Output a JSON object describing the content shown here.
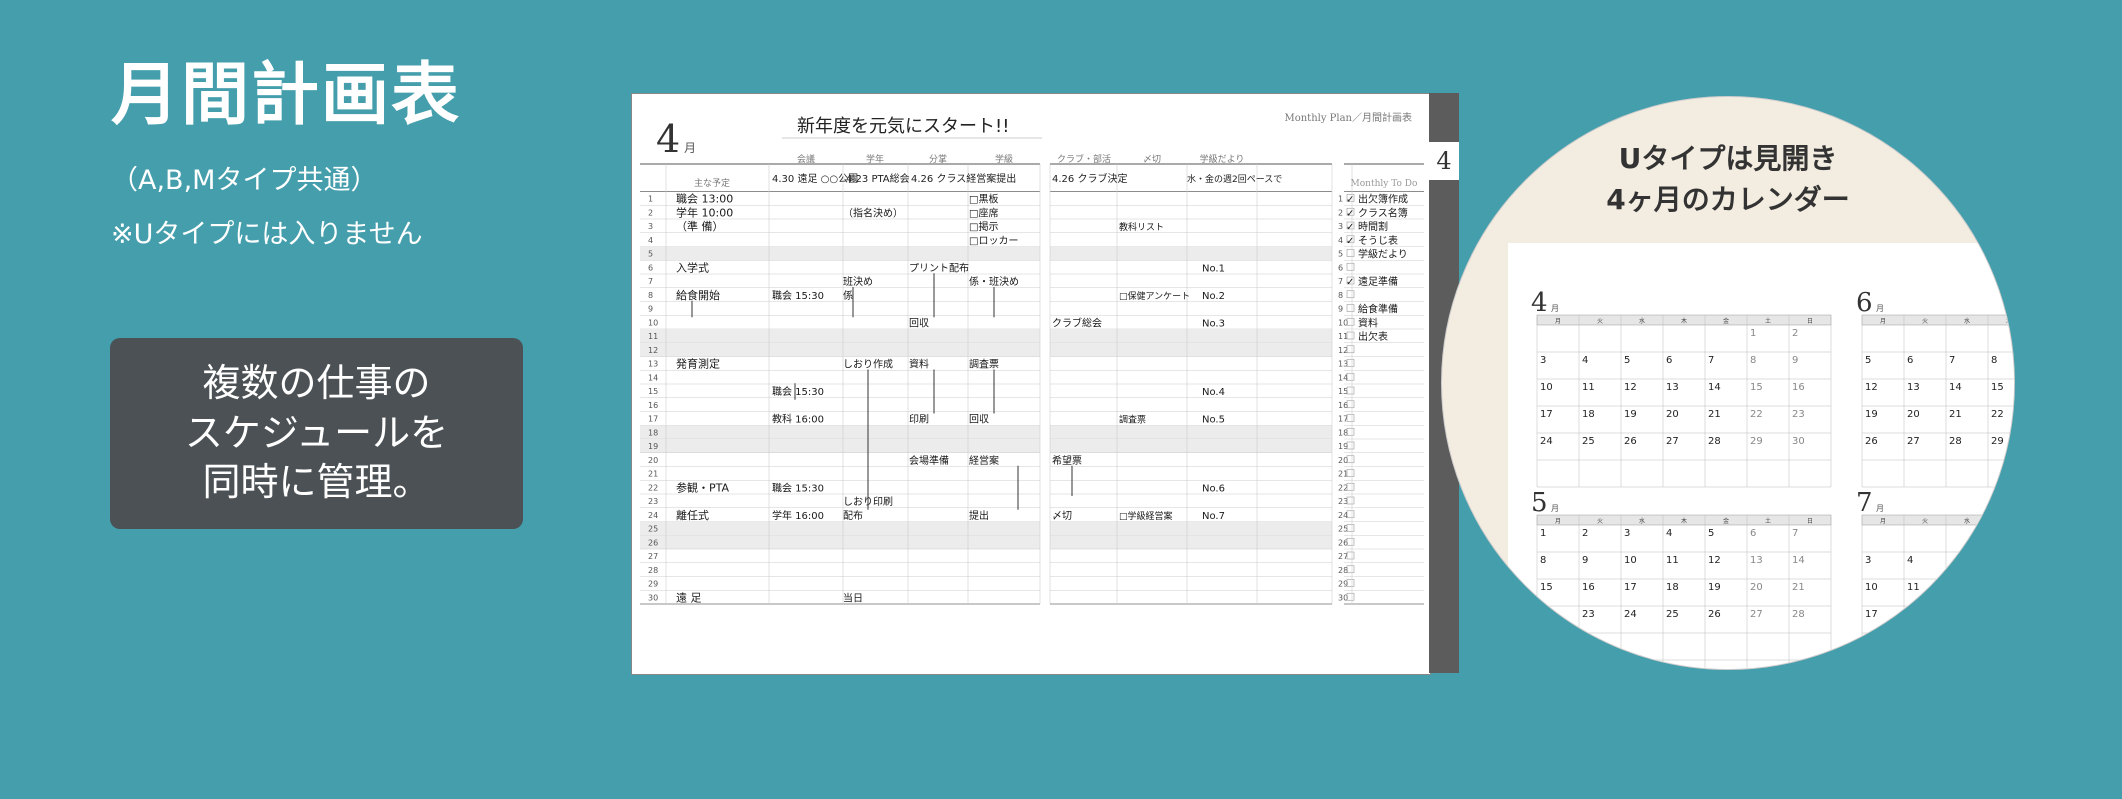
{
  "hero": {
    "title": "月間計画表",
    "subtitle": "（A,B,Mタイプ共通）",
    "note": "※Uタイプには入りません"
  },
  "callout": {
    "line1": "複数の仕事の",
    "line2": "スケジュールを",
    "line3": "同時に管理。"
  },
  "planner": {
    "month": "4",
    "month_unit": "月",
    "header_right": "Monthly Plan／月間計画表",
    "theme": "新年度を元気にスタート!!",
    "main_col": "主な予定",
    "columns": [
      "会議",
      "学年",
      "分掌",
      "学級"
    ],
    "columns2": [
      "クラブ・部活",
      "〆切",
      "学級だより"
    ],
    "todo_label": "Monthly To Do",
    "tab_number": "4",
    "top_cells": [
      "4.30 遠足 ○○公園",
      "4.23 PTA総会",
      "4.26 クラス経営案提出",
      "4.26 クラブ決定",
      "水・金の週2回ペースで"
    ],
    "events": [
      {
        "day": 1,
        "text": "職会 13:00"
      },
      {
        "day": 2,
        "text": "学年 10:00"
      },
      {
        "day": 3,
        "text": "（準 備）"
      },
      {
        "day": 6,
        "text": "入学式"
      },
      {
        "day": 8,
        "text": "給食開始"
      },
      {
        "day": 13,
        "text": "発育測定"
      },
      {
        "day": 22,
        "text": "参観・PTA"
      },
      {
        "day": 24,
        "text": "離任式"
      },
      {
        "day": 30,
        "text": "遠 足"
      }
    ],
    "meetings": [
      {
        "day": 8,
        "text": "職会 15:30"
      },
      {
        "day": 15,
        "text": "職会 15:30"
      },
      {
        "day": 17,
        "text": "教科 16:00"
      },
      {
        "day": 22,
        "text": "職会 15:30"
      },
      {
        "day": 24,
        "text": "学年 16:00"
      }
    ],
    "grade": [
      {
        "day": 2,
        "text": "（指名決め）"
      },
      {
        "day": 7,
        "text": "班決め"
      },
      {
        "day": 8,
        "text": "係"
      },
      {
        "day": 13,
        "text": "しおり作成"
      },
      {
        "day": 23,
        "text": "しおり印刷"
      },
      {
        "day": 24,
        "text": "配布"
      },
      {
        "day": 30,
        "text": "当日"
      }
    ],
    "bunsho": [
      {
        "day": 6,
        "text": "プリント配布"
      },
      {
        "day": 10,
        "text": "回収"
      },
      {
        "day": 13,
        "text": "資料"
      },
      {
        "day": 17,
        "text": "印刷"
      },
      {
        "day": 20,
        "text": "会場準備"
      }
    ],
    "gakkyu": [
      {
        "day": 1,
        "text": "□黒板"
      },
      {
        "day": 2,
        "text": "□座席"
      },
      {
        "day": 3,
        "text": "□掲示"
      },
      {
        "day": 4,
        "text": "□ロッカー"
      },
      {
        "day": 7,
        "text": "係・班決め"
      },
      {
        "day": 13,
        "text": "調査票"
      },
      {
        "day": 17,
        "text": "回収"
      },
      {
        "day": 20,
        "text": "経営案"
      },
      {
        "day": 24,
        "text": "提出"
      }
    ],
    "club": [
      {
        "day": 10,
        "text": "クラブ総会"
      },
      {
        "day": 20,
        "text": "希望票"
      },
      {
        "day": 24,
        "text": "〆切"
      }
    ],
    "deadlines": [
      {
        "day": 3,
        "text": "教科リスト"
      },
      {
        "day": 8,
        "text": "□保健アンケート"
      },
      {
        "day": 17,
        "text": "調査票"
      },
      {
        "day": 24,
        "text": "□学級経営案"
      }
    ],
    "newsletter": [
      {
        "day": 6,
        "text": "No.1"
      },
      {
        "day": 8,
        "text": "No.2"
      },
      {
        "day": 10,
        "text": "No.3"
      },
      {
        "day": 15,
        "text": "No.4"
      },
      {
        "day": 17,
        "text": "No.5"
      },
      {
        "day": 22,
        "text": "No.6"
      },
      {
        "day": 24,
        "text": "No.7"
      }
    ],
    "todos": [
      {
        "text": "出欠簿作成",
        "checked": true
      },
      {
        "text": "クラス名簿",
        "checked": true
      },
      {
        "text": "時間割",
        "checked": true
      },
      {
        "text": "そうじ表",
        "checked": true
      },
      {
        "text": "学級だより",
        "checked": false
      },
      {
        "text": "",
        "checked": false
      },
      {
        "text": "遠足準備",
        "checked": true
      },
      {
        "text": "",
        "checked": false
      },
      {
        "text": "給食準備",
        "checked": false
      },
      {
        "text": "資料",
        "checked": false
      },
      {
        "text": "出欠表",
        "checked": false
      }
    ]
  },
  "circle": {
    "title1": "Uタイプは見開き",
    "title2": "4ヶ月のカレンダー",
    "weekdays": [
      "月",
      "火",
      "水",
      "木",
      "金",
      "土",
      "日"
    ],
    "months": [
      {
        "month": "4",
        "rows": [
          [
            "",
            "",
            "",
            "",
            "",
            "1",
            "2"
          ],
          [
            "3",
            "4",
            "5",
            "6",
            "7",
            "8",
            "9"
          ],
          [
            "10",
            "11",
            "12",
            "13",
            "14",
            "15",
            "16"
          ],
          [
            "17",
            "18",
            "19",
            "20",
            "21",
            "22",
            "23"
          ],
          [
            "24",
            "25",
            "26",
            "27",
            "28",
            "29",
            "30"
          ],
          [
            "",
            "",
            "",
            "",
            "",
            "",
            ""
          ]
        ]
      },
      {
        "month": "6",
        "rows": [
          [
            "",
            "",
            "",
            "",
            "1",
            "",
            ""
          ],
          [
            "5",
            "6",
            "7",
            "8",
            "",
            "",
            ""
          ],
          [
            "12",
            "13",
            "14",
            "15",
            "",
            "",
            ""
          ],
          [
            "19",
            "20",
            "21",
            "22",
            "",
            "",
            ""
          ],
          [
            "26",
            "27",
            "28",
            "29",
            "",
            "",
            ""
          ],
          [
            "",
            "",
            "",
            "",
            "",
            "",
            ""
          ]
        ]
      },
      {
        "month": "5",
        "rows": [
          [
            "1",
            "2",
            "3",
            "4",
            "5",
            "6",
            "7"
          ],
          [
            "8",
            "9",
            "10",
            "11",
            "12",
            "13",
            "14"
          ],
          [
            "15",
            "16",
            "17",
            "18",
            "19",
            "20",
            "21"
          ],
          [
            "22",
            "23",
            "24",
            "25",
            "26",
            "27",
            "28"
          ],
          [
            "",
            "",
            "",
            "",
            "",
            "",
            ""
          ],
          [
            "",
            "",
            "",
            "",
            "",
            "",
            ""
          ]
        ]
      },
      {
        "month": "7",
        "rows": [
          [
            "",
            "",
            "",
            "",
            "",
            "",
            ""
          ],
          [
            "3",
            "4",
            "",
            "",
            "",
            "",
            ""
          ],
          [
            "10",
            "11",
            "",
            "",
            "",
            "",
            ""
          ],
          [
            "17",
            "18",
            "",
            "",
            "",
            "",
            ""
          ],
          [
            "",
            "",
            "",
            "",
            "",
            "",
            ""
          ],
          [
            "",
            "",
            "",
            "",
            "",
            "",
            ""
          ]
        ]
      }
    ]
  }
}
